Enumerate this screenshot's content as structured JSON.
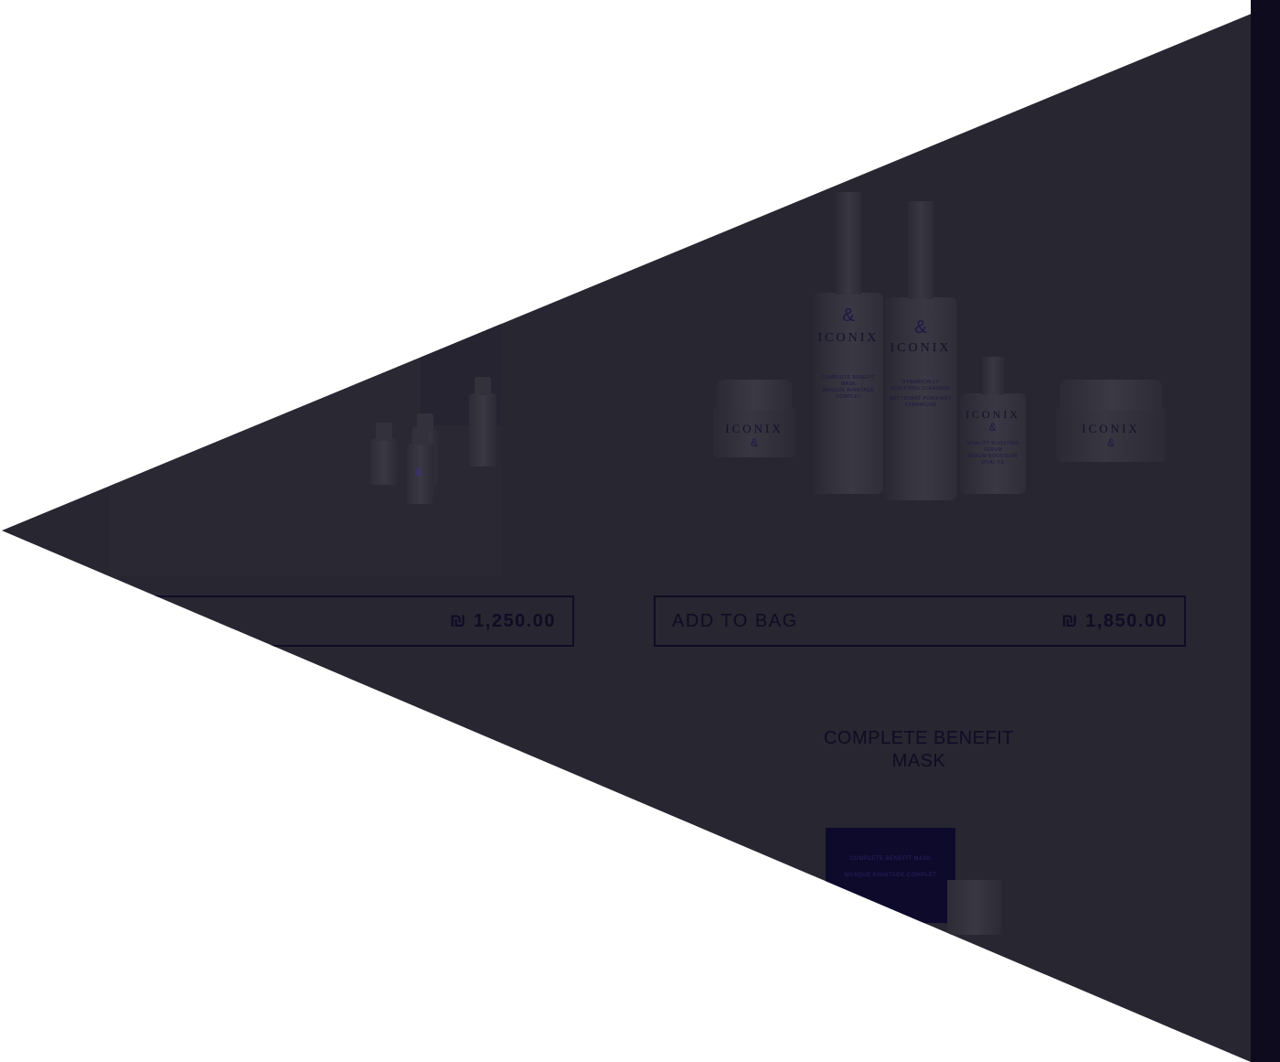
{
  "left_product": {
    "price": "₪ 1,250.00"
  },
  "right_product": {
    "add_to_bag_label": "ADD TO BAG",
    "price": "₪ 1,850.00",
    "image": {
      "brand": "ICONIX",
      "bottle_1_lines": [
        "COMPLETE BENEFIT MASK",
        "MASQUE AVANTAGE COMPLET"
      ],
      "bottle_2_lines": [
        "DYNAMICALLY PURIFYING CLEANSER",
        "NETTOYANT PURIFIANT DYNAMIQUE"
      ],
      "bottle_3_lines": [
        "VITALITY BOOSTING SERUM",
        "SÉRUM BOOSTEUR VITALITÉ"
      ]
    }
  },
  "featured_product": {
    "title": "COMPLETE BENEFIT MASK",
    "package_lines": [
      "COMPLETE BENEFIT MASK",
      "MASQUE AVANTAGE COMPLET"
    ]
  },
  "colors": {
    "overlay": "#282631",
    "ink": "#0f0c24",
    "scrollbar": "#0d0b1d"
  }
}
